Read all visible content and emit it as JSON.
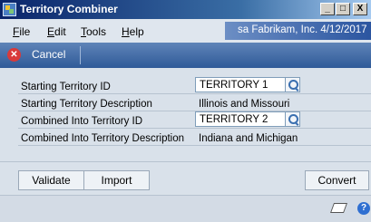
{
  "window": {
    "title": "Territory Combiner",
    "title_bar_buttons": {
      "minimize": "_",
      "maximize": "□",
      "close": "X"
    }
  },
  "menu": {
    "items": [
      {
        "label": "File",
        "accel": "F",
        "rest": "ile"
      },
      {
        "label": "Edit",
        "accel": "E",
        "rest": "dit"
      },
      {
        "label": "Tools",
        "accel": "T",
        "rest": "ools"
      },
      {
        "label": "Help",
        "accel": "H",
        "rest": "elp"
      }
    ],
    "status": "sa  Fabrikam, Inc.  4/12/2017"
  },
  "toolbar": {
    "cancel_label": "Cancel",
    "cancel_icon": "✕"
  },
  "form": {
    "starting_id_label": "Starting Territory ID",
    "starting_id_value": "TERRITORY 1",
    "starting_desc_label": "Starting Territory Description",
    "starting_desc_value": "Illinois and Missouri",
    "combined_id_label": "Combined Into Territory ID",
    "combined_id_value": "TERRITORY 2",
    "combined_desc_label": "Combined Into Territory Description",
    "combined_desc_value": "Indiana and Michigan"
  },
  "buttons": {
    "validate": "Validate",
    "import": "Import",
    "convert": "Convert"
  },
  "footer": {
    "help_icon": "?"
  }
}
